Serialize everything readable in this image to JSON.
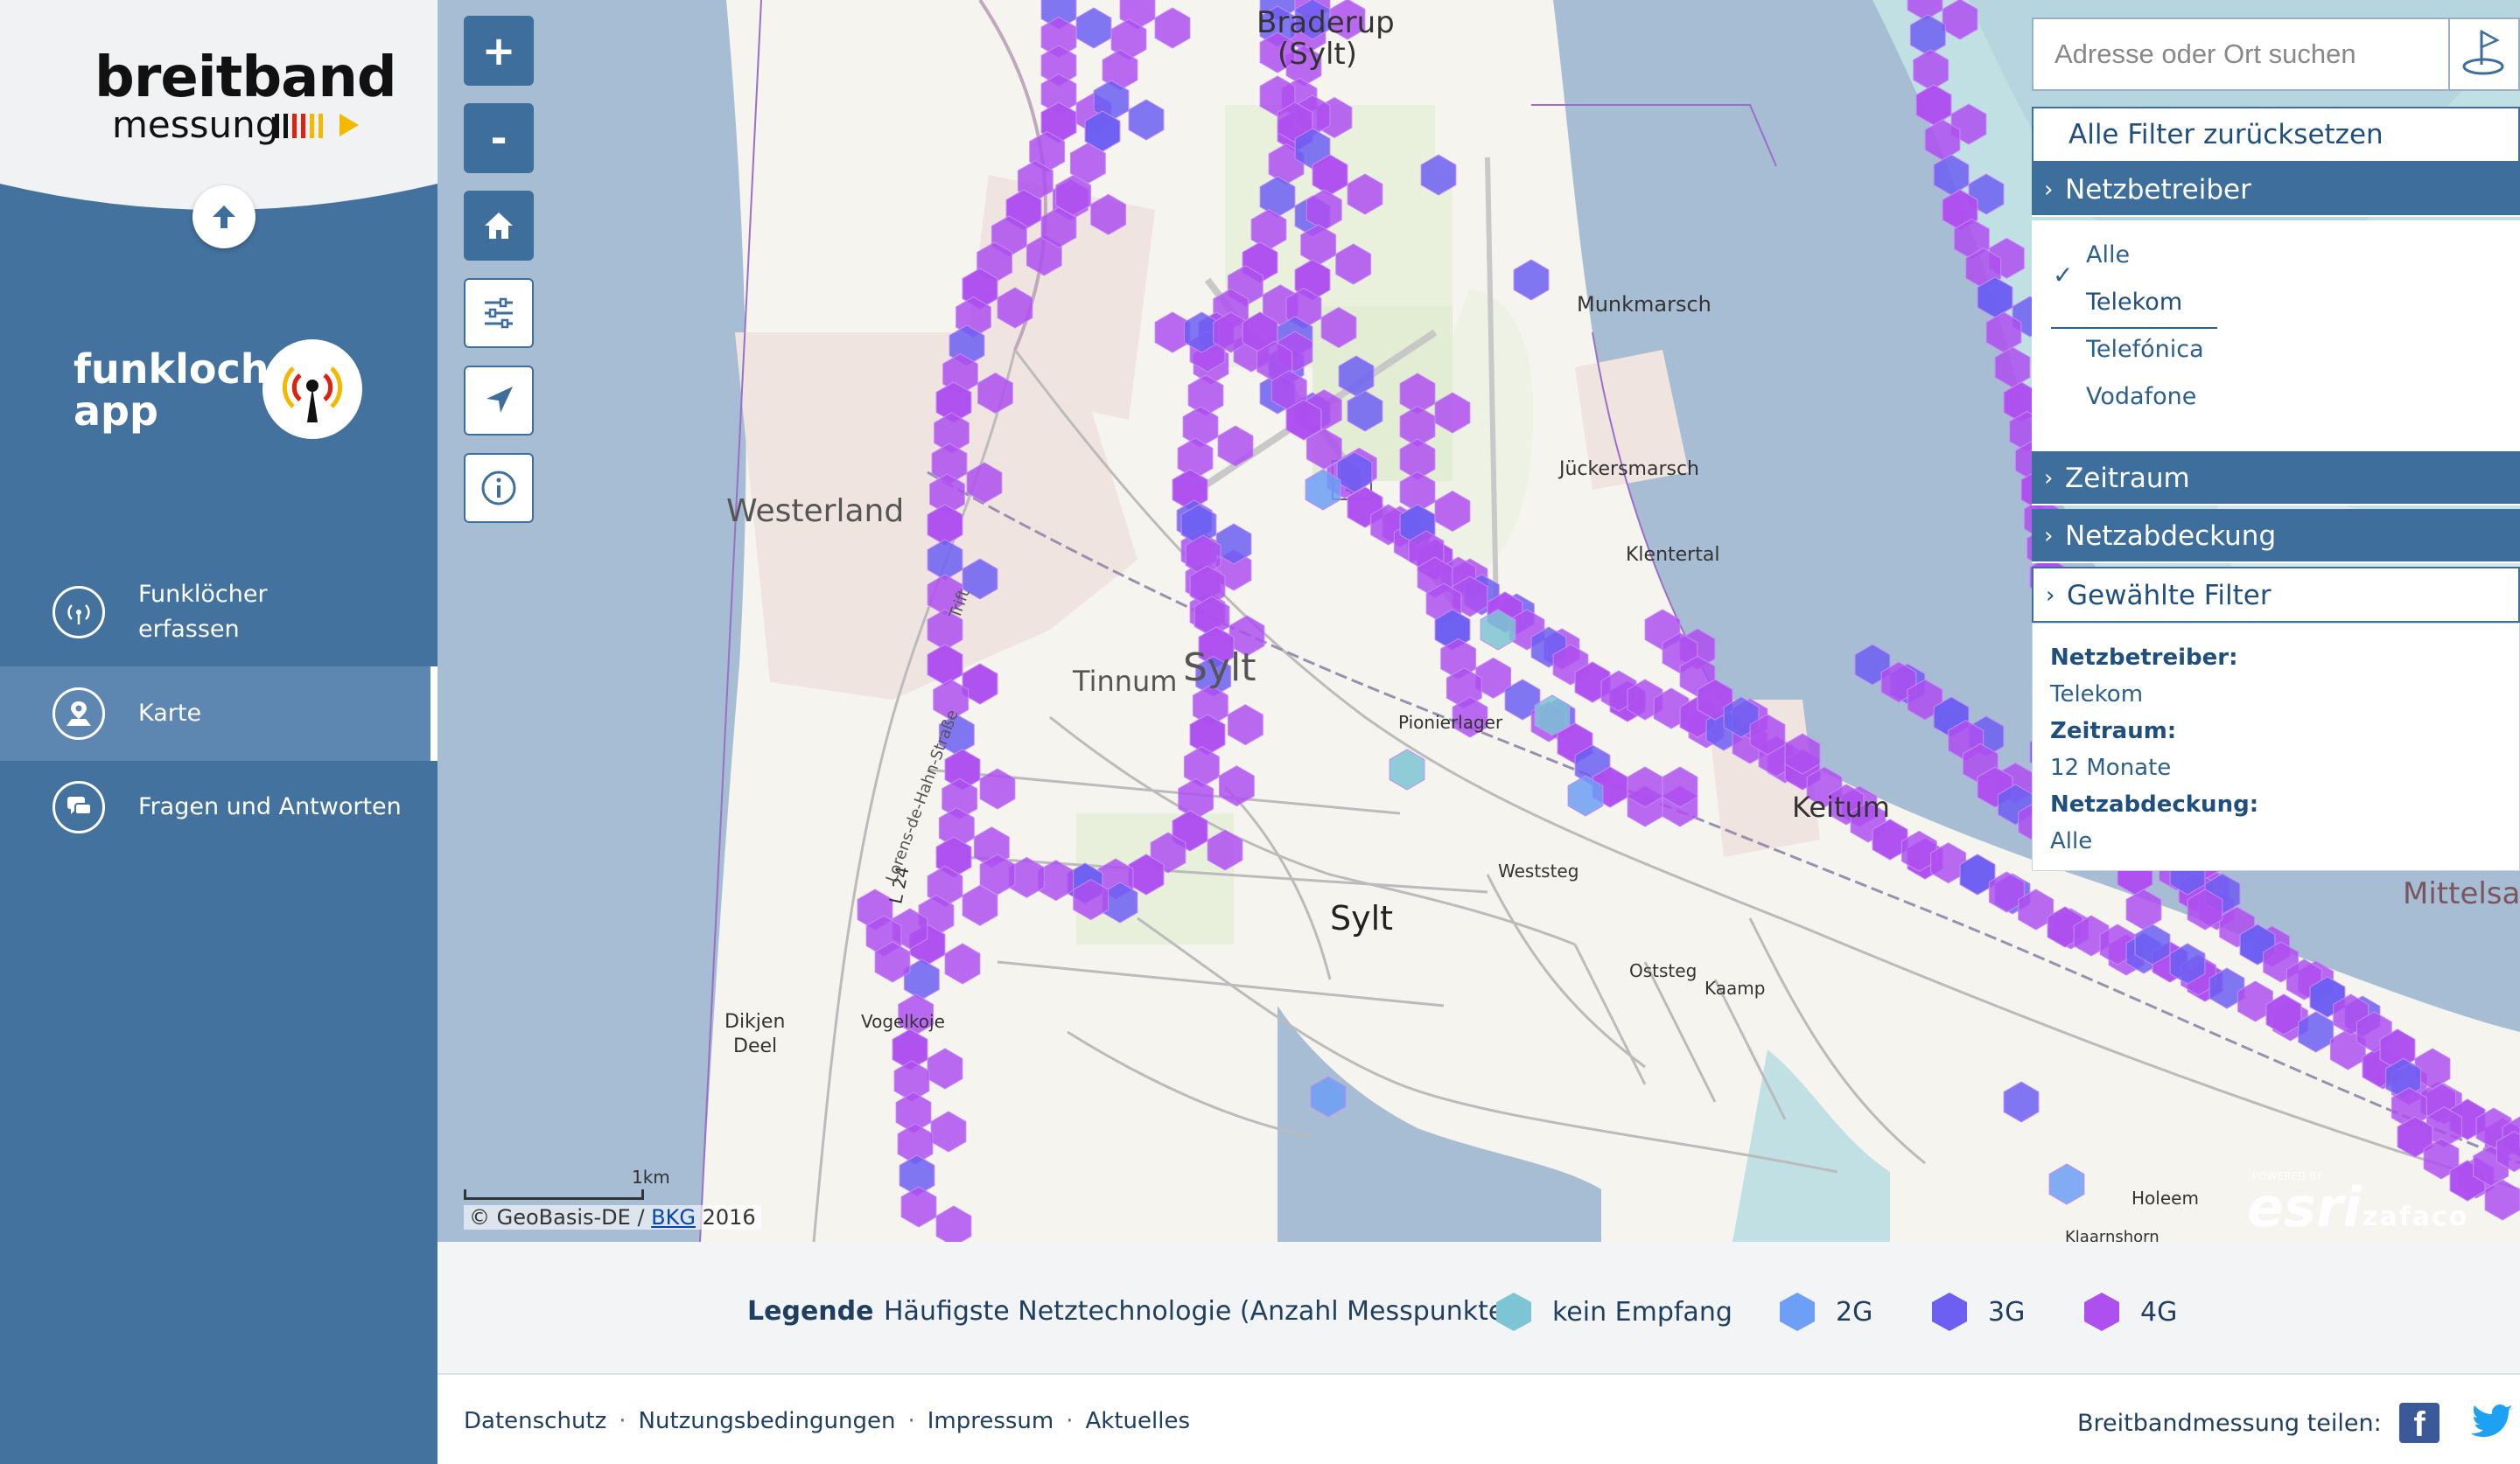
{
  "brand": {
    "line1": "breitband",
    "line2": "messung"
  },
  "app": {
    "title_line1": "funkloch-",
    "title_line2": "app"
  },
  "nav": [
    {
      "label_line1": "Funklöcher",
      "label_line2": "erfassen",
      "icon": "antenna-icon"
    },
    {
      "label": "Karte",
      "icon": "map-pin-icon",
      "active": true
    },
    {
      "label": "Fragen und Antworten",
      "icon": "chat-icon"
    }
  ],
  "map": {
    "controls": {
      "zoom_in": "+",
      "zoom_out": "-"
    },
    "labels": {
      "braderup": "Braderup",
      "braderup_sub": "(Sylt)",
      "munkmarsch": "Munkmarsch",
      "juckersmarsch": "Jückersmarsch",
      "klentertal": "Klentertal",
      "westerland": "Westerland",
      "tinnum": "Tinnum",
      "sylt_big": "Sylt",
      "pionierlager": "Pionierlager",
      "keitum": "Keitum",
      "weststeg": "Weststeg",
      "sylt_center": "Sylt",
      "oststeg": "Oststeg",
      "kaamp": "Kaamp",
      "mittelsa": "Mittelsa",
      "dikjen": "Dikjen",
      "deel": "Deel",
      "vogelkoje": "Vogelkoje",
      "holeem": "Holeem",
      "klaarnshorn": "Klaarnshorn",
      "road": "L 24",
      "street": "Lorens-de-Hahn-Straße",
      "trift": "Trift"
    },
    "scale": "1km",
    "attribution_prefix": "© GeoBasis-DE / ",
    "attribution_link": "BKG",
    "attribution_suffix": " 2016",
    "powered": "POWERED BY",
    "esri": "esri",
    "zafaco": "zafaco"
  },
  "search": {
    "placeholder": "Adresse oder Ort suchen"
  },
  "filters": {
    "reset": "Alle Filter zurücksetzen",
    "provider_header": "Netzbetreiber",
    "providers": [
      "Alle",
      "Telekom",
      "Telefónica",
      "Vodafone"
    ],
    "selected_provider": "Telekom",
    "period_header": "Zeitraum",
    "coverage_header": "Netzabdeckung",
    "chosen_header": "Gewählte Filter",
    "chosen": {
      "provider_label": "Netzbetreiber:",
      "provider_value": "Telekom",
      "period_label": "Zeitraum:",
      "period_value": "12 Monate",
      "coverage_label": "Netzabdeckung:",
      "coverage_value": "Alle"
    }
  },
  "legend": {
    "title": "Legende",
    "description": "Häufigste Netztechnologie (Anzahl Messpunkte)",
    "items": [
      {
        "label": "kein Empfang",
        "color": "#7dc4d4"
      },
      {
        "label": "2G",
        "color": "#6c9ff5"
      },
      {
        "label": "3G",
        "color": "#6c5ff2"
      },
      {
        "label": "4G",
        "color": "#ae4ff0"
      }
    ]
  },
  "footer": {
    "links": [
      "Datenschutz",
      "Nutzungsbedingungen",
      "Impressum",
      "Aktuelles"
    ],
    "share": "Breitbandmessung teilen:"
  },
  "colors": {
    "sidebar": "#43729e",
    "accent": "#3e6f9c",
    "hex4g": "#ae4ff0",
    "hex3g": "#6c5ff2",
    "hex2g": "#6c9ff5",
    "hexnone": "#7dc4d4"
  }
}
